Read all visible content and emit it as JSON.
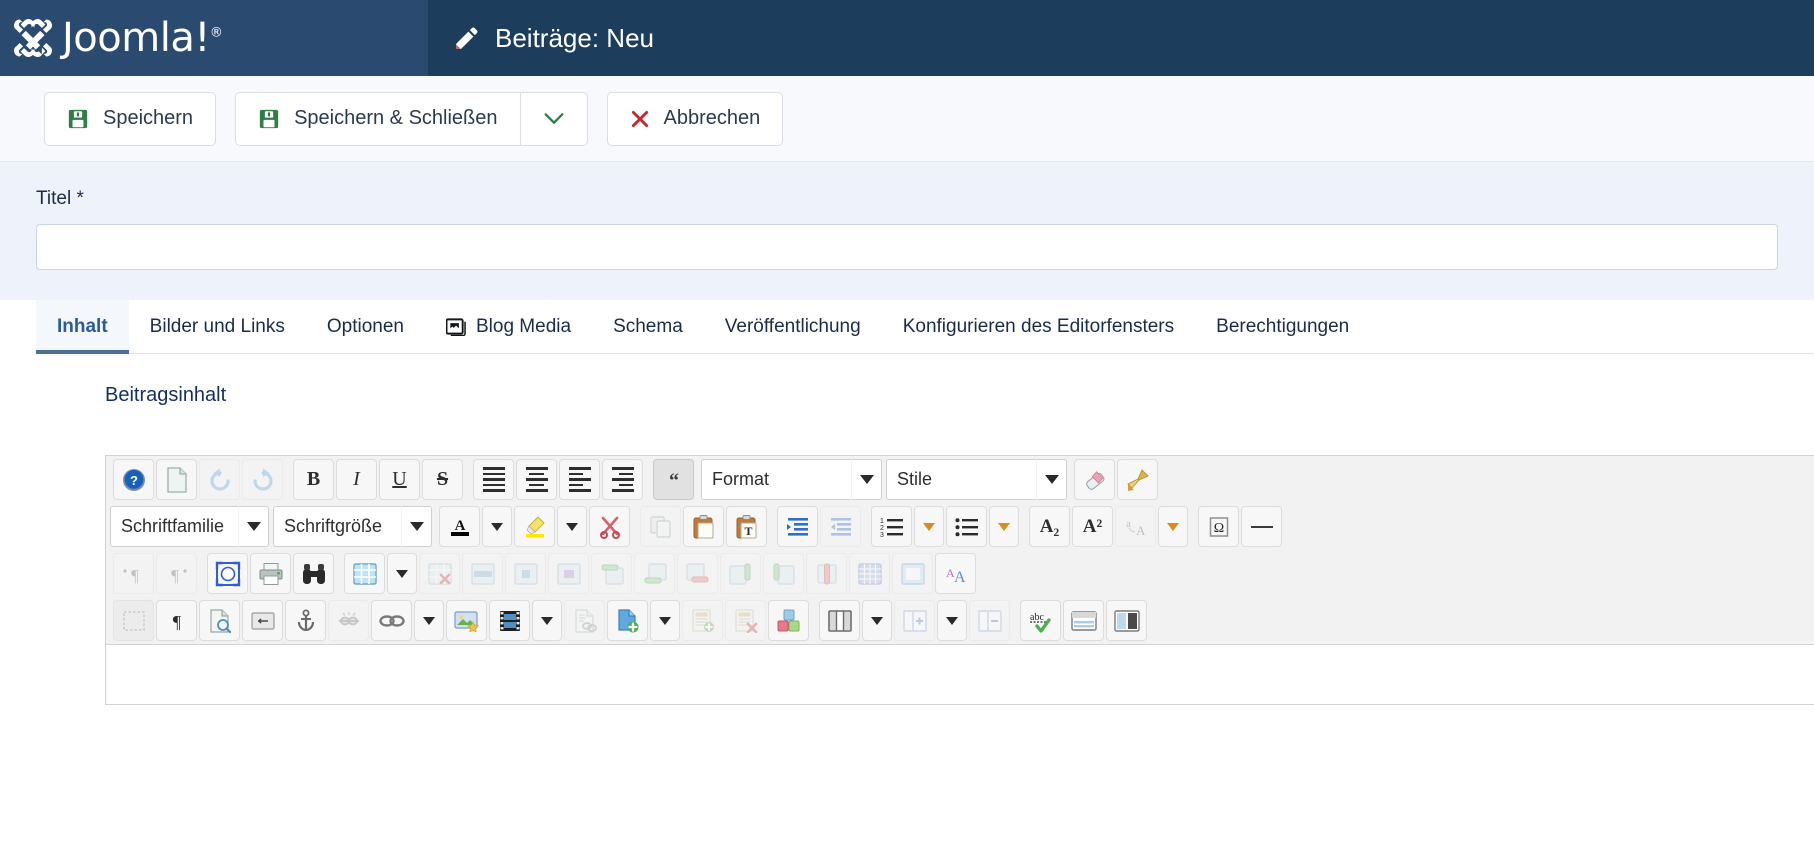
{
  "header": {
    "brand_name": "Joomla!",
    "brand_trademark": "®",
    "brand_icon": "joomla-logo-icon",
    "page_icon": "pencil-icon",
    "page_title": "Beiträge: Neu"
  },
  "toolbar": {
    "save_label": "Speichern",
    "save_icon": "save-disk-icon",
    "save_close_label": "Speichern & Schließen",
    "save_close_icon": "save-disk-icon",
    "dropdown_icon": "chevron-down-icon",
    "cancel_label": "Abbrechen",
    "cancel_icon": "close-x-icon"
  },
  "form": {
    "title_label": "Titel *",
    "title_value": "",
    "title_placeholder": ""
  },
  "tabs": [
    {
      "label": "Inhalt",
      "icon": null,
      "active": true
    },
    {
      "label": "Bilder und Links",
      "icon": null,
      "active": false
    },
    {
      "label": "Optionen",
      "icon": null,
      "active": false
    },
    {
      "label": "Blog Media",
      "icon": "images-icon",
      "active": false
    },
    {
      "label": "Schema",
      "icon": null,
      "active": false
    },
    {
      "label": "Veröffentlichung",
      "icon": null,
      "active": false
    },
    {
      "label": "Konfigurieren des Editorfensters",
      "icon": null,
      "active": false
    },
    {
      "label": "Berechtigungen",
      "icon": null,
      "active": false
    }
  ],
  "editor": {
    "section_title": "Beitragsinhalt",
    "format_select": {
      "value": "Format",
      "caret_icon": "caret-down-icon"
    },
    "styles_select": {
      "value": "Stile",
      "caret_icon": "caret-down-icon"
    },
    "fontfamily_select": {
      "value": "Schriftfamilie",
      "caret_icon": "caret-down-icon"
    },
    "fontsize_select": {
      "value": "Schriftgröße",
      "caret_icon": "caret-down-icon"
    },
    "bold_label": "B",
    "italic_label": "I",
    "underline_label": "U",
    "strike_label": "S",
    "subscript_label": "A₂",
    "superscript_label": "A²",
    "omega_label": "Ω",
    "rows": [
      {
        "name": "row-1",
        "buttons": [
          "help-icon",
          "new-document-icon",
          "undo-icon",
          "redo-icon",
          "bold-icon",
          "italic-icon",
          "underline-icon",
          "strikethrough-icon",
          "align-justify-icon",
          "align-center-icon",
          "align-left-icon",
          "align-right-icon",
          "blockquote-icon",
          "format-select",
          "styles-select",
          "eraser-icon",
          "paintbrush-icon"
        ]
      },
      {
        "name": "row-2",
        "buttons": [
          "fontfamily-select",
          "fontsize-select",
          "text-color-icon",
          "text-color-caret-icon",
          "highlight-color-icon",
          "highlight-color-caret-icon",
          "cut-scissors-icon",
          "copy-icon",
          "paste-icon",
          "paste-as-text-icon",
          "indent-icon",
          "outdent-icon",
          "numbered-list-icon",
          "numbered-list-caret-icon",
          "bullet-list-icon",
          "bullet-list-caret-icon",
          "subscript-icon",
          "superscript-icon",
          "change-case-icon",
          "change-case-caret-icon",
          "special-character-icon",
          "horizontal-rule-icon"
        ]
      },
      {
        "name": "row-3",
        "buttons": [
          "ltr-paragraph-icon",
          "rtl-paragraph-icon",
          "fullscreen-icon",
          "print-icon",
          "search-binoculars-icon",
          "insert-table-icon",
          "insert-table-caret-icon",
          "delete-table-icon",
          "table-row-properties-icon",
          "table-cell-properties-icon",
          "merge-cells-icon",
          "insert-row-before-icon",
          "insert-row-after-icon",
          "delete-row-icon",
          "insert-column-before-icon",
          "insert-column-after-icon",
          "delete-column-icon",
          "table-grid-icon",
          "table-borders-icon",
          "font-size-aa-icon"
        ]
      },
      {
        "name": "row-4",
        "buttons": [
          "show-borders-icon",
          "show-invisibles-icon",
          "page-preview-icon",
          "page-break-icon",
          "anchor-icon",
          "unlink-icon",
          "link-icon",
          "link-caret-icon",
          "insert-image-icon",
          "insert-media-icon",
          "insert-media-caret-icon",
          "document-link-icon",
          "add-module-icon",
          "add-module-caret-icon",
          "add-article-icon",
          "delete-article-icon",
          "add-extension-icon",
          "columns-icon",
          "columns-caret-icon",
          "add-column-icon",
          "add-column-caret-icon",
          "remove-column-icon",
          "spellcheck-icon",
          "readmore-icon",
          "pagebreak-panel-icon"
        ]
      }
    ]
  },
  "colors": {
    "brand_dark": "#1c3d5c",
    "brand_panel": "#2b4a6f",
    "accent": "#2a5c96",
    "save_green": "#2f7d47",
    "cancel_red": "#c8252a",
    "title_bg": "#edf2fb",
    "tab_active_underline": "#4a6f99"
  }
}
